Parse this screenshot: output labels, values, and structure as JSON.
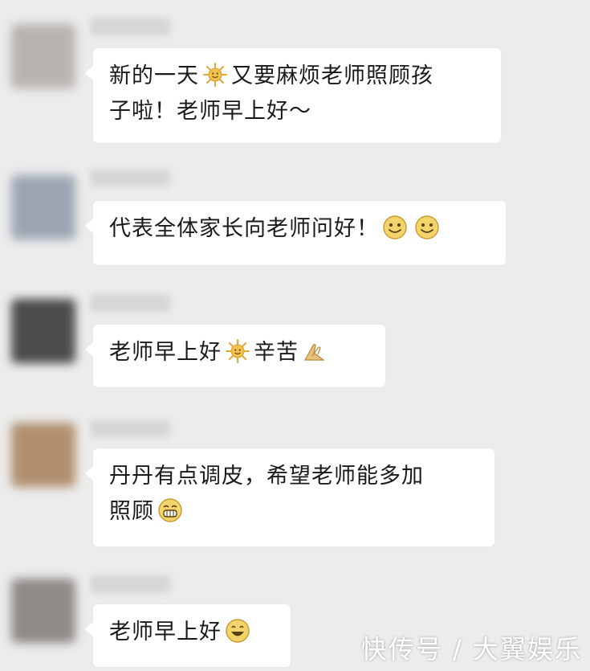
{
  "messages": [
    {
      "id": "m1",
      "avatar_color": "#b7b3ae",
      "parts": [
        {
          "type": "text",
          "value": "新的一天"
        },
        {
          "type": "emoji",
          "icon": "sun-icon"
        },
        {
          "type": "text",
          "value": "又要麻烦老师照顾孩"
        },
        {
          "type": "break"
        },
        {
          "type": "text",
          "value": "子啦！老师早上好～"
        }
      ]
    },
    {
      "id": "m2",
      "avatar_color": "#9ba5b2",
      "parts": [
        {
          "type": "text",
          "value": "代表全体家长向老师问好！"
        },
        {
          "type": "emoji",
          "icon": "smile-icon"
        },
        {
          "type": "emoji",
          "icon": "smile-icon"
        }
      ]
    },
    {
      "id": "m3",
      "avatar_color": "#4b4b4e",
      "parts": [
        {
          "type": "text",
          "value": "老师早上好"
        },
        {
          "type": "emoji",
          "icon": "sun-icon"
        },
        {
          "type": "text",
          "value": "辛苦"
        },
        {
          "type": "emoji",
          "icon": "praying-hands-icon"
        }
      ]
    },
    {
      "id": "m4",
      "avatar_color": "#b0906f",
      "parts": [
        {
          "type": "text",
          "value": "丹丹有点调皮，希望老师能多加"
        },
        {
          "type": "break"
        },
        {
          "type": "text",
          "value": "照顾"
        },
        {
          "type": "emoji",
          "icon": "grin-icon"
        }
      ]
    },
    {
      "id": "m5",
      "avatar_color": "#8e8a86",
      "parts": [
        {
          "type": "text",
          "value": "老师早上好"
        },
        {
          "type": "emoji",
          "icon": "happy-face-icon"
        }
      ]
    }
  ],
  "watermark": "快传号 / 大翼娱乐"
}
